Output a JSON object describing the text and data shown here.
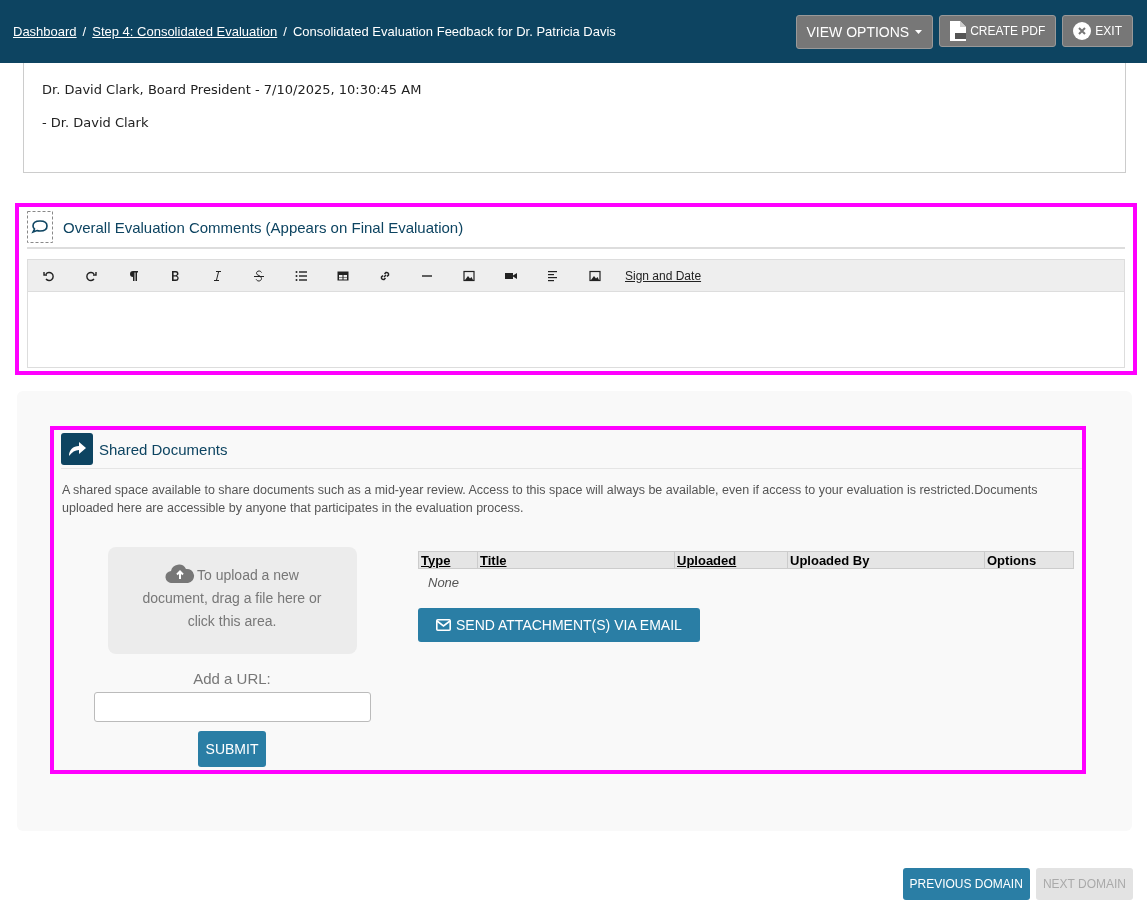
{
  "breadcrumbs": [
    {
      "label": "Dashboard",
      "link": true,
      "separator": "/"
    },
    {
      "label": "Step 4: Consolidated Evaluation",
      "link": true,
      "separator": "/"
    },
    {
      "label": "Consolidated Evaluation Feedback for Dr. Patricia Davis",
      "link": false
    }
  ],
  "header_buttons": [
    {
      "label": "VIEW OPTIONS",
      "kind": "dropdown"
    },
    {
      "label": "CREATE PDF",
      "kind": "pdf"
    },
    {
      "label": "EXIT",
      "kind": "exit"
    }
  ],
  "feedback_card": {
    "lines": [
      "Dr. David Clark, Board President - 7/10/2025, 10:30:45 AM",
      "- Dr. David Clark"
    ]
  },
  "comments": {
    "title": "Overall Evaluation Comments (Appears on Final Evaluation)",
    "highlighted": true,
    "toolbar": [
      {
        "kind": "undo"
      },
      {
        "kind": "redo"
      },
      {
        "kind": "paragraph"
      },
      {
        "kind": "bold"
      },
      {
        "kind": "italic"
      },
      {
        "kind": "strike"
      },
      {
        "kind": "list"
      },
      {
        "kind": "table"
      },
      {
        "kind": "link"
      },
      {
        "kind": "rule"
      },
      {
        "kind": "image"
      },
      {
        "kind": "video"
      },
      {
        "kind": "align"
      },
      {
        "kind": "image"
      },
      {
        "kind": "text",
        "label": "Sign and Date"
      }
    ]
  },
  "shared_documents": {
    "title": "Shared Documents",
    "highlighted": true,
    "description": "A shared space available to share documents such as a mid-year review. Access to this space will always be available, even if access to your evaluation is restricted.Documents uploaded here are accessible by anyone that participates in the evaluation process.",
    "upload_area": "To upload a new document, drag a file here or click this area.",
    "url_label": "Add a URL:",
    "submit": "SUBMIT",
    "columns": [
      {
        "label": "Type",
        "sortable": true
      },
      {
        "label": "Title",
        "sortable": true
      },
      {
        "label": "Uploaded",
        "sortable": true
      },
      {
        "label": "Uploaded By",
        "sortable": false
      },
      {
        "label": "Options",
        "sortable": false
      }
    ],
    "empty": "None",
    "email_button": "SEND ATTACHMENT(S) VIA EMAIL"
  },
  "footer_buttons": [
    {
      "label": "PREVIOUS DOMAIN",
      "disabled": false
    },
    {
      "label": "NEXT DOMAIN",
      "disabled": true
    }
  ]
}
